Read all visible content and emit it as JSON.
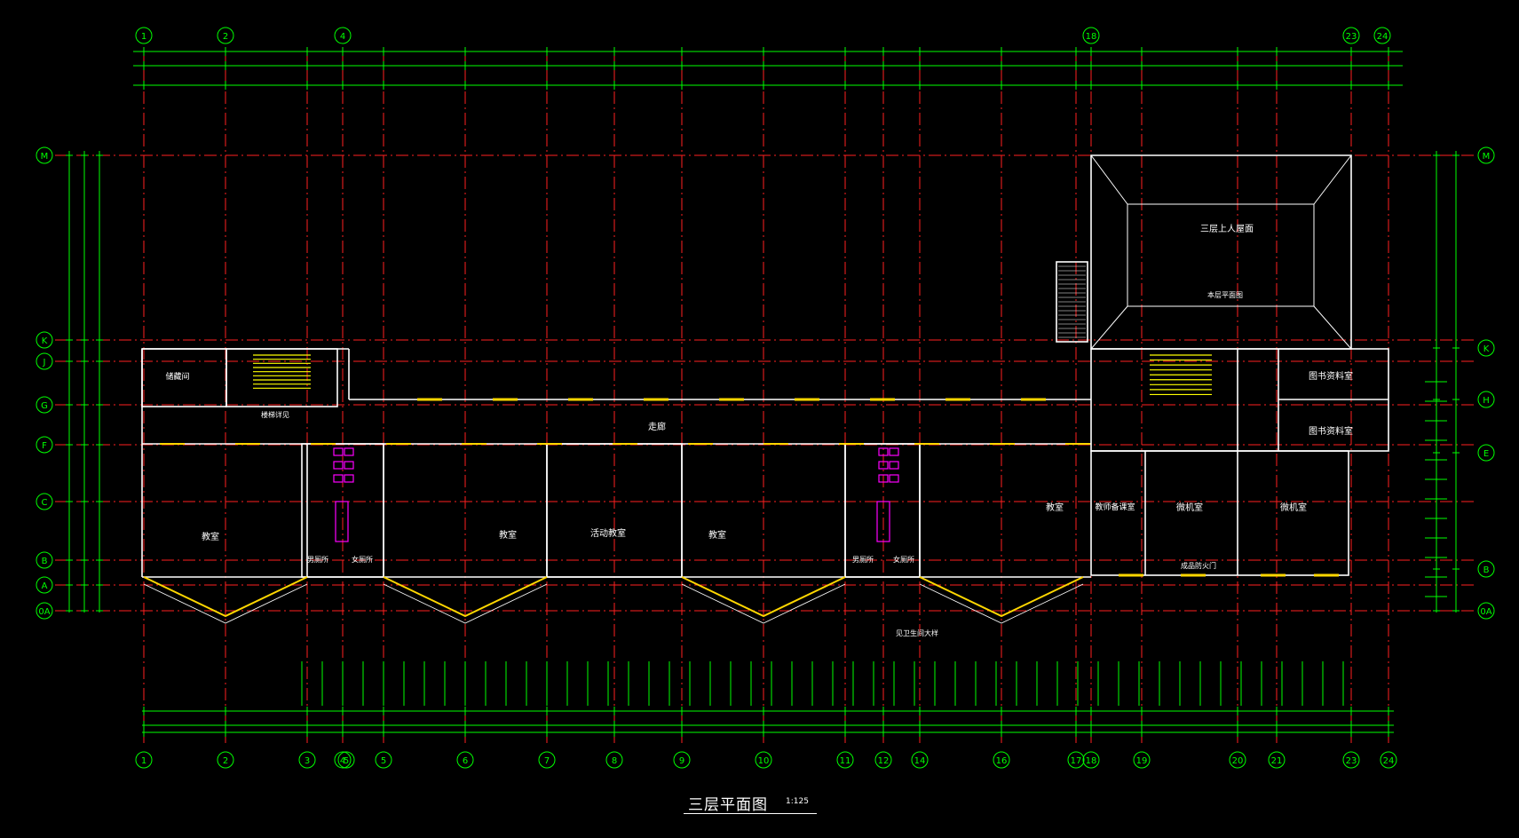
{
  "drawing": {
    "title": "三层平面图",
    "scale": "1:125"
  },
  "colors": {
    "background": "#000000",
    "wall": "#ffffff",
    "axis_line": "#ff2020",
    "dimension": "#00ff00",
    "window": "#ffd700",
    "stair": "#ffff00",
    "fixture": "#ff00ff",
    "text": "#ffffff"
  },
  "grid": {
    "vertical_axes": [
      "1",
      "2",
      "3",
      "4",
      "5",
      "6",
      "7",
      "8",
      "9",
      "10",
      "11",
      "12",
      "14",
      "16",
      "17",
      "18",
      "19",
      "20",
      "21",
      "23",
      "24"
    ],
    "top_axes": [
      "1",
      "2",
      "4",
      "18",
      "23",
      "24"
    ],
    "horizontal_axes_left": [
      "M",
      "K",
      "J",
      "G",
      "F",
      "C",
      "B",
      "A",
      "0A"
    ],
    "horizontal_axes_right": [
      "M",
      "K",
      "H",
      "E",
      "B",
      "0A"
    ]
  },
  "rooms": {
    "classroom": "教室",
    "activity_room": "活动教室",
    "corridor": "走廊",
    "storage": "储藏间",
    "male_wc": "男厕所",
    "female_wc": "女厕所",
    "library": "图书资料室",
    "teacher_office": "教师备课室",
    "computer_room": "微机室",
    "roof_terrace": "三层上人屋面",
    "roof_note": "本层平面图"
  },
  "notes": {
    "stair_note": "楼梯详见",
    "wc_note": "见卫生间大样",
    "door_note": "成品防火门"
  }
}
